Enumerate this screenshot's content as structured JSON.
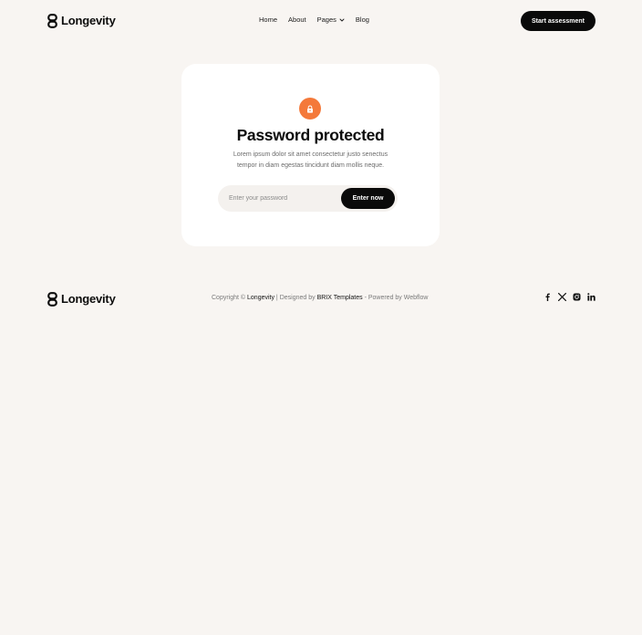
{
  "header": {
    "logo_text": "Longevity",
    "nav": [
      {
        "label": "Home"
      },
      {
        "label": "About"
      },
      {
        "label": "Pages",
        "has_dropdown": true
      },
      {
        "label": "Blog"
      }
    ],
    "cta_label": "Start assessment"
  },
  "card": {
    "icon": "lock-icon",
    "title": "Password protected",
    "description": "Lorem ipsum dolor sit amet consectetur justo senectus tempor in diam egestas tincidunt diam mollis neque.",
    "password_placeholder": "Enter your password",
    "submit_label": "Enter now"
  },
  "footer": {
    "logo_text": "Longevity",
    "copyright_prefix": "Copyright © ",
    "copyright_brand": "Longevity",
    "designed_by_prefix": " | Designed by ",
    "designer": "BRIX Templates",
    "powered_by": " - Powered by Webflow",
    "socials": [
      "facebook-icon",
      "x-icon",
      "instagram-icon",
      "linkedin-icon"
    ]
  },
  "colors": {
    "background": "#f8f5f2",
    "accent": "#f4793a",
    "primary": "#0a0a0a",
    "card": "#ffffff"
  }
}
